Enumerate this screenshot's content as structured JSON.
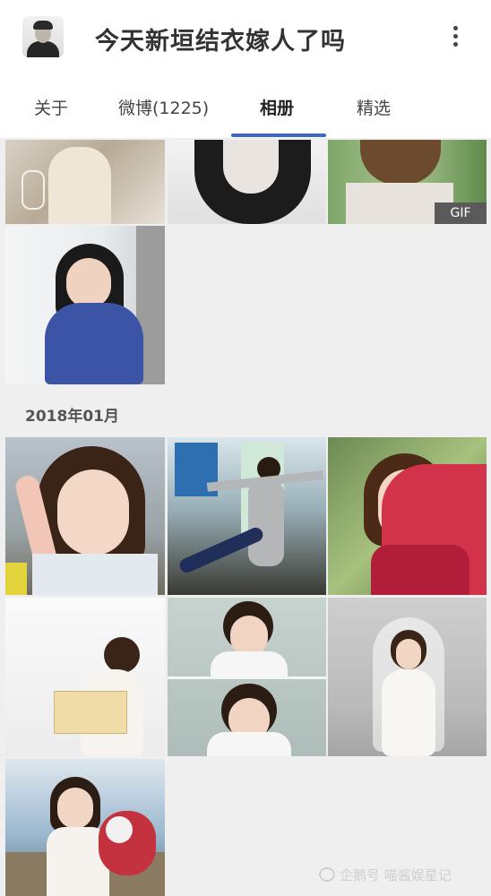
{
  "header": {
    "title": "今天新垣结衣嫁人了吗",
    "avatar_icon": "user-avatar",
    "more_icon": "more-vertical-icon"
  },
  "tabs": [
    {
      "label": "关于",
      "active": false
    },
    {
      "label": "微博(1225)",
      "active": false
    },
    {
      "label": "相册",
      "active": true
    },
    {
      "label": "精选",
      "active": false
    }
  ],
  "accent_color": "#3f67c9",
  "album": {
    "top_row_gif_badge": "GIF",
    "section_label": "2018年01月"
  },
  "watermark": "企鹅号 喵酱娱星记"
}
